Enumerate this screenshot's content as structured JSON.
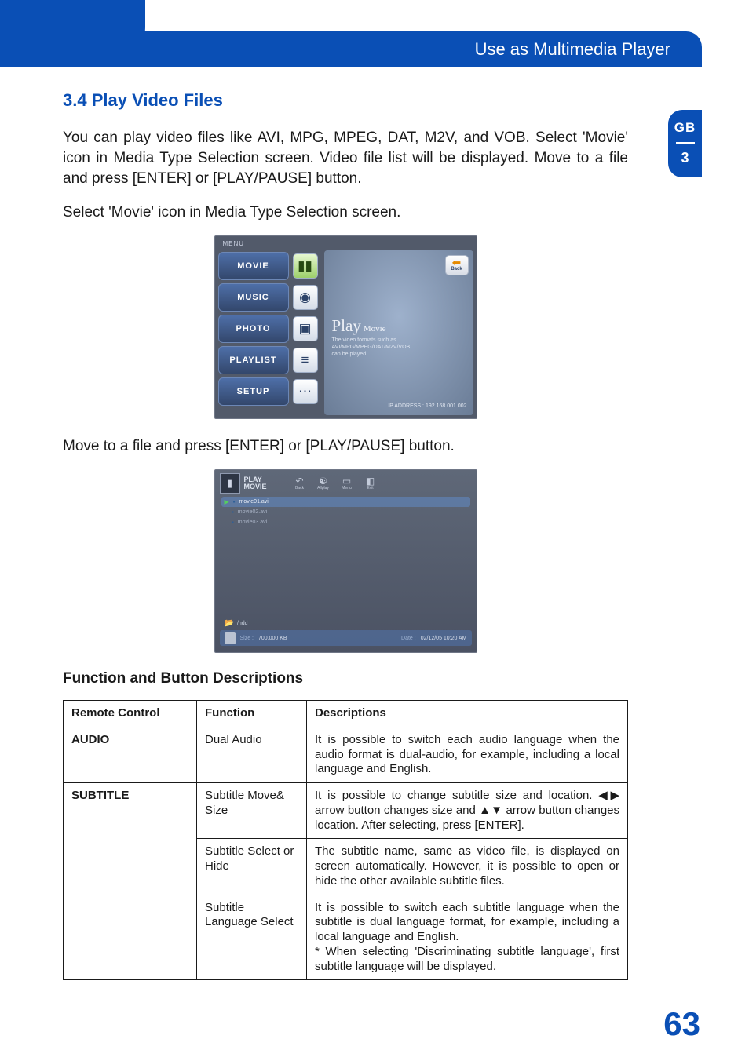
{
  "header": {
    "title": "Use as Multimedia Player"
  },
  "sideTab": {
    "lang": "GB",
    "chapter": "3"
  },
  "section": {
    "heading": "3.4 Play Video Files",
    "para1": "You can play video files like AVI, MPG, MPEG, DAT, M2V, and VOB. Select 'Movie' icon in Media Type Selection screen. Video file list will be displayed. Move to a file and press [ENTER] or [PLAY/PAUSE] button.",
    "para2": "Select 'Movie' icon in Media Type Selection screen.",
    "para3": "Move to a file and press [ENTER] or [PLAY/PAUSE] button."
  },
  "shot1": {
    "menuLabel": "MENU",
    "items": [
      "MOVIE",
      "MUSIC",
      "PHOTO",
      "PLAYLIST",
      "SETUP"
    ],
    "back": "Back",
    "bigTitle": "Play",
    "bigSub": "Movie",
    "desc1": "The video formats such as",
    "desc2": "AVI/MPG/MPEG/DAT/M2V/VOB",
    "desc3": "can be played.",
    "ip": "IP ADDRESS : 192.168.001.002"
  },
  "shot2": {
    "titleTop": "PLAY",
    "titleBot": "MOVIE",
    "toolbar": [
      "Back",
      "Allplay",
      "Menu",
      "Exit"
    ],
    "files": [
      "movie01.avi",
      "movie02.avi",
      "movie03.avi"
    ],
    "path": "/hdd",
    "sizeLabel": "Size :",
    "sizeValue": "700,000 KB",
    "dateLabel": "Date :",
    "dateValue": "02/12/05  10:20  AM"
  },
  "tableTitle": "Function and Button Descriptions",
  "table": {
    "headers": {
      "c1": "Remote Control",
      "c2": "Function",
      "c3": "Descriptions"
    },
    "rows": [
      {
        "rc": "AUDIO",
        "sub": [
          {
            "fn": "Dual Audio",
            "desc": "It is possible to switch each audio language when the audio format is dual-audio, for example, including a local language and English."
          }
        ]
      },
      {
        "rc": "SUBTITLE",
        "sub": [
          {
            "fn": "Subtitle Move& Size",
            "desc_pre": "It is possible to change subtitle size and location. ",
            "desc_mid": " arrow button changes size and ",
            "desc_post": " arrow button changes location. After selecting, press [ENTER]."
          },
          {
            "fn": "Subtitle Select or Hide",
            "desc": "The subtitle name, same as video file, is displayed on screen automatically. However, it is possible to open or hide the other available subtitle files."
          },
          {
            "fn": "Subtitle Language Select",
            "desc": "It is possible to switch each subtitle language when the subtitle is dual language format, for example, including a local language and English.\n* When selecting 'Discriminating subtitle language', first subtitle language will be displayed."
          }
        ]
      }
    ]
  },
  "pageNumber": "63"
}
